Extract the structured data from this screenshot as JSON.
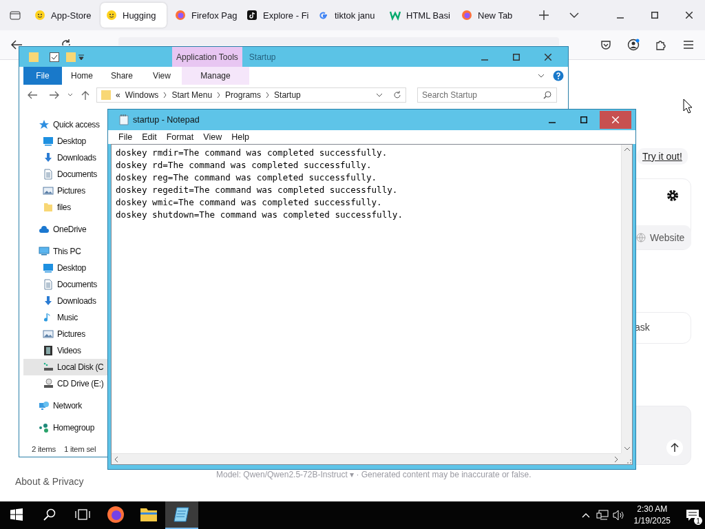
{
  "browser": {
    "tabs": [
      {
        "label": "App-Store",
        "kind": "smiley",
        "selected": false
      },
      {
        "label": "Hugging",
        "kind": "smiley",
        "selected": true
      },
      {
        "label": "Firefox Pag",
        "kind": "firefox",
        "selected": false
      },
      {
        "label": "Explore - Fi",
        "kind": "tiktok",
        "selected": false
      },
      {
        "label": "tiktok janu",
        "kind": "google",
        "selected": false
      },
      {
        "label": "HTML Basi",
        "kind": "w",
        "selected": false
      },
      {
        "label": "New Tab",
        "kind": "firefox",
        "selected": false
      }
    ],
    "page": {
      "try_link": "Try it out!",
      "website_button": "Website",
      "ask_card": "ask",
      "footer_model": "Model: Qwen/Qwen2.5-72B-Instruct ▾",
      "footer_note": "· Generated content may be inaccurate or false.",
      "about_link": "About & Privacy"
    }
  },
  "explorer": {
    "ribbon_context": "Application Tools",
    "title": "Startup",
    "ribbon_tabs": [
      {
        "label": "File",
        "selected": true
      },
      {
        "label": "Home",
        "selected": false
      },
      {
        "label": "Share",
        "selected": false
      },
      {
        "label": "View",
        "selected": false
      },
      {
        "label": "Manage",
        "selected": false
      }
    ],
    "path": [
      "«",
      "Windows",
      "Start Menu",
      "Programs",
      "Startup"
    ],
    "search": {
      "placeholder": "Search Startup"
    },
    "nav": [
      {
        "label": "Quick access",
        "kind": "star",
        "selected": false,
        "children": [
          {
            "label": "Desktop",
            "kind": "desktop",
            "selected": false
          },
          {
            "label": "Downloads",
            "kind": "download",
            "selected": false
          },
          {
            "label": "Documents",
            "kind": "document",
            "selected": false
          },
          {
            "label": "Pictures",
            "kind": "pictures",
            "selected": false
          },
          {
            "label": "files",
            "kind": "folder",
            "selected": false
          }
        ]
      },
      {
        "label": "OneDrive",
        "kind": "cloud",
        "selected": false
      },
      {
        "label": "This PC",
        "kind": "pc",
        "selected": false,
        "children": [
          {
            "label": "Desktop",
            "kind": "desktop",
            "selected": false
          },
          {
            "label": "Documents",
            "kind": "document",
            "selected": false
          },
          {
            "label": "Downloads",
            "kind": "download",
            "selected": false
          },
          {
            "label": "Music",
            "kind": "music",
            "selected": false
          },
          {
            "label": "Pictures",
            "kind": "pictures",
            "selected": false
          },
          {
            "label": "Videos",
            "kind": "video",
            "selected": false
          },
          {
            "label": "Local Disk (C",
            "kind": "disk",
            "selected": true
          },
          {
            "label": "CD Drive (E:)",
            "kind": "cd",
            "selected": false
          }
        ]
      },
      {
        "label": "Network",
        "kind": "network",
        "selected": false
      },
      {
        "label": "Homegroup",
        "kind": "homegroup",
        "selected": false
      }
    ],
    "status": [
      "2 items",
      "1 item sel"
    ]
  },
  "notepad": {
    "title": "startup - Notepad",
    "menu": [
      "File",
      "Edit",
      "Format",
      "View",
      "Help"
    ],
    "lines": [
      "doskey rmdir=The command was completed successfully.",
      "doskey rd=The command was completed successfully.",
      "doskey reg=The command was completed successfully.",
      "doskey regedit=The command was completed successfully.",
      "doskey wmic=The command was completed successfully.",
      "doskey shutdown=The command was completed successfully."
    ]
  },
  "taskbar": {
    "apps": [
      {
        "kind": "firefox",
        "active": false
      },
      {
        "kind": "explorer",
        "active": false
      },
      {
        "kind": "notepad",
        "active": true
      }
    ],
    "time": "2:30 AM",
    "date": "1/19/2025",
    "notifications": "1"
  }
}
